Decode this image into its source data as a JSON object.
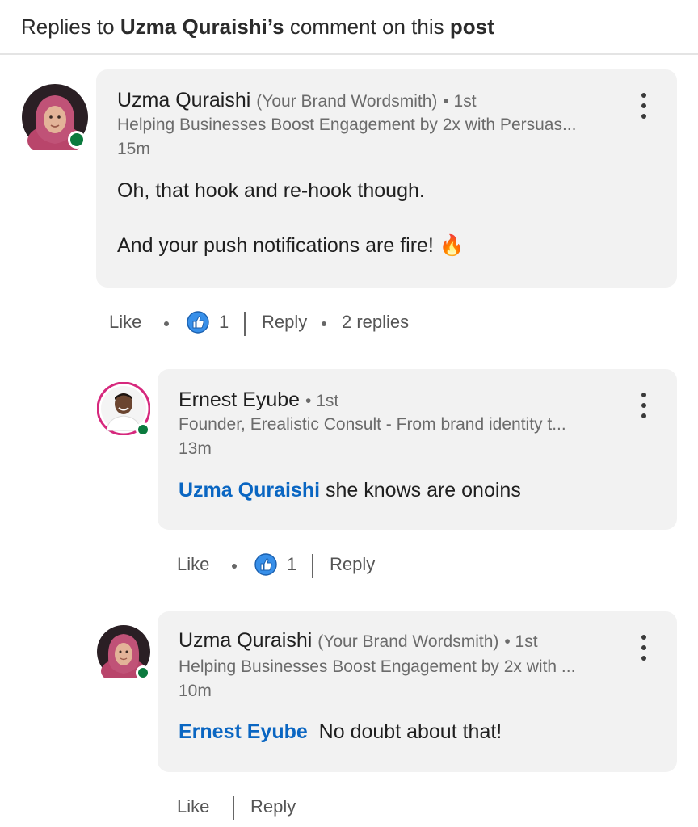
{
  "header": {
    "title_prefix": "Replies to",
    "title_name": "Uzma Quraishi’s",
    "title_middle": "comment on this",
    "title_suffix": "post"
  },
  "comments": [
    {
      "author": "Uzma Quraishi",
      "role": "(Your Brand Wordsmith)",
      "degree": "• 1st",
      "headline": "Helping Businesses Boost Engagement by 2x with Persuas...",
      "time": "15m",
      "line1": "Oh, that hook and re-hook though.",
      "line2": "And your push notifications are fire! 🔥",
      "like_label": "Like",
      "like_count": "1",
      "reply_label": "Reply",
      "replies_count": "2 replies"
    },
    {
      "author": "Ernest Eyube",
      "degree": "• 1st",
      "headline": "Founder, Erealistic Consult - From brand identity t...",
      "time": "13m",
      "mention": "Uzma Quraishi",
      "text": " she knows are onoins",
      "like_label": "Like",
      "like_count": "1",
      "reply_label": "Reply"
    },
    {
      "author": "Uzma Quraishi",
      "role": "(Your Brand Wordsmith)",
      "degree": "• 1st",
      "headline": "Helping Businesses Boost Engagement by 2x with ...",
      "time": "10m",
      "mention": "Ernest Eyube",
      "text": "  No doubt about that!",
      "like_label": "Like",
      "reply_label": "Reply"
    }
  ],
  "colors": {
    "mention": "#0a66c2",
    "online": "#0b7a3e",
    "bubble": "#f2f2f2",
    "like_blue": "#378fe9"
  },
  "icons": [
    "more-vertical-icon",
    "like-thumb-icon",
    "online-status-icon"
  ]
}
